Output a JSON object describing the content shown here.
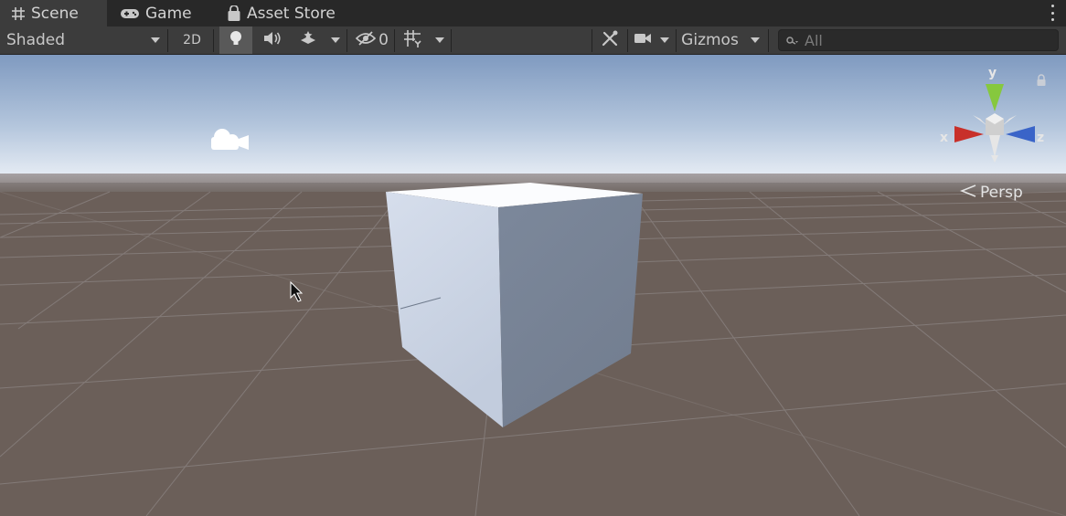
{
  "tabs": [
    {
      "label": "Scene",
      "icon": "grid-icon",
      "active": true
    },
    {
      "label": "Game",
      "icon": "gamepad-icon",
      "active": false
    },
    {
      "label": "Asset Store",
      "icon": "shopping-bag-icon",
      "active": false
    }
  ],
  "toolbar": {
    "draw_mode": "Shaded",
    "mode_2d": "2D",
    "lighting_icon": "lightbulb-icon",
    "audio_icon": "speaker-icon",
    "effects_icon": "effects-icon",
    "hidden_count": "0",
    "grid_icon": "grid-snap-icon",
    "tools_icon": "tools-icon",
    "camera_icon": "camera-icon",
    "gizmos": "Gizmos",
    "search_placeholder": "All"
  },
  "viewport": {
    "projection": "Persp",
    "axes": {
      "x": "x",
      "y": "y",
      "z": "z"
    },
    "colors": {
      "sky_top": "#7f9ac0",
      "horizon": "#e6ecf4",
      "ground": "#6b5f59",
      "cube_top": "#fbfcfe",
      "cube_left": "#ccd6e6",
      "cube_right": "#7a8597"
    }
  }
}
